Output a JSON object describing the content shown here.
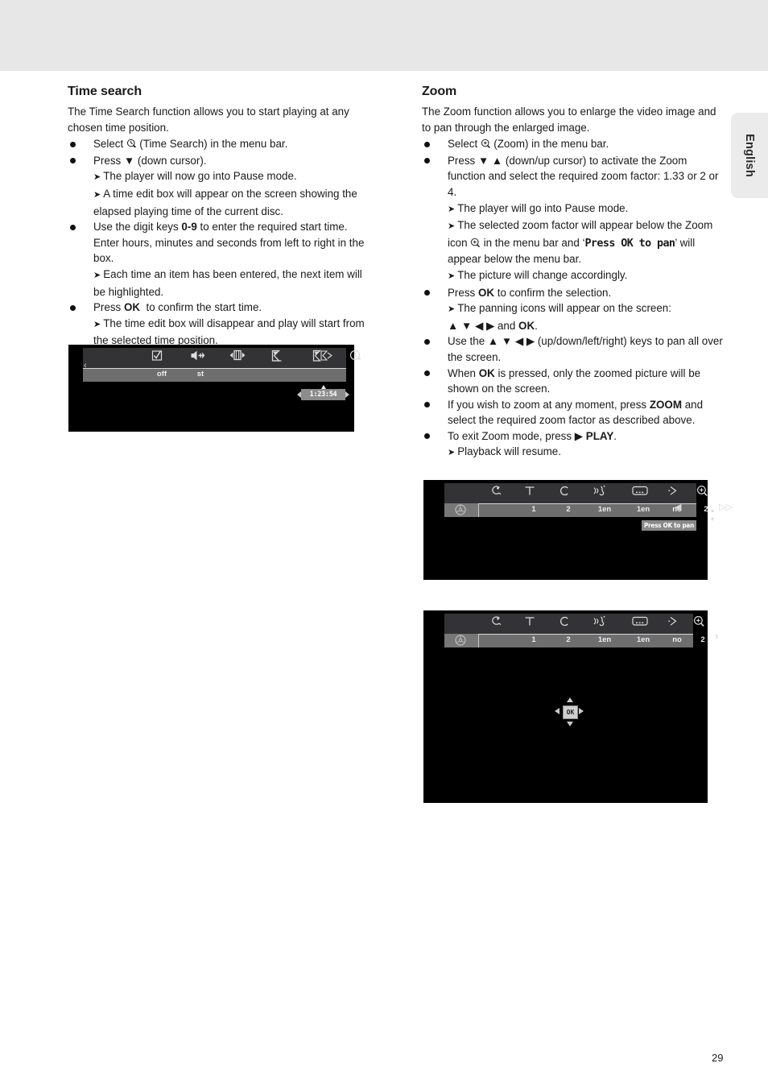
{
  "language_tab": {
    "label": "English"
  },
  "page_number": "29",
  "left_column": {
    "heading": "Time search",
    "intro": "The Time Search function allows you to start playing at any chosen time position.",
    "items": [
      {
        "kind": "bullet",
        "parts": [
          "Select ",
          "(Time Search) in the menu bar."
        ],
        "icon": "time-search-icon"
      },
      {
        "kind": "bullet",
        "text": "Press ▼ (down cursor)."
      },
      {
        "kind": "arrow",
        "text": "The player will now go into Pause mode."
      },
      {
        "kind": "arrow",
        "text": "A time edit box will appear on the screen showing the elapsed playing time of the current disc."
      },
      {
        "kind": "bullet",
        "text": "Use the digit keys 0-9 to enter the required start time. Enter hours, minutes and seconds from left to right in the box.",
        "bold": "0-9"
      },
      {
        "kind": "arrow",
        "text": "Each time an item has been entered, the next item will be highlighted."
      },
      {
        "kind": "bullet",
        "text": "Press OK  to confirm the start time.",
        "bold": "OK"
      },
      {
        "kind": "arrow",
        "text": "The time edit box will disappear and play will start from the selected time position."
      }
    ]
  },
  "right_column": {
    "heading": "Zoom",
    "intro": "The Zoom function allows you to enlarge the video image and to pan through the enlarged image.",
    "items": [
      {
        "kind": "bullet",
        "text": "Select (Zoom) in the menu bar."
      },
      {
        "kind": "bullet",
        "text": "Press ▼ ▲ (down/up cursor) to activate the Zoom function and select the required zoom factor: 1.33 or 2 or 4."
      },
      {
        "kind": "arrow",
        "text": "The player will go into Pause mode."
      },
      {
        "kind": "arrow",
        "text": "The selected zoom factor will appear below the Zoom icon in the menu bar and ‘Press OK to pan’ will appear below the menu bar."
      },
      {
        "kind": "arrow",
        "text": "The picture will change accordingly."
      },
      {
        "kind": "bullet",
        "text": "Press OK to confirm the selection."
      },
      {
        "kind": "arrow",
        "text": "The panning icons will appear on the screen:"
      },
      {
        "kind": "plain",
        "text": "▲ ▼ ◀ ▶ and OK."
      },
      {
        "kind": "bullet",
        "text": "Use the ▲ ▼ ◀ ▶ (up/down/left/right) keys to pan all over the screen."
      },
      {
        "kind": "bullet",
        "text": "When OK is pressed, only the zoomed picture will be shown on the screen."
      },
      {
        "kind": "bullet",
        "text": "If you wish to zoom at any moment, press ZOOM and select the required zoom factor as described above."
      },
      {
        "kind": "bullet",
        "text": "To exit Zoom mode, press ▶ PLAY."
      },
      {
        "kind": "arrow",
        "text": "Playback will resume."
      }
    ],
    "press_ok_to_pan_inline": "Press OK to pan"
  },
  "screenshots": {
    "time_search": {
      "name": "time-search-osd",
      "menu_icons": [
        "subtitle-check-icon",
        "audio-language-icon",
        "screen-format-icon",
        "slow-motion-icon",
        "fast-forward-icon",
        "time-search-icon"
      ],
      "menu_values": [
        "off",
        "st",
        "",
        "",
        "",
        ""
      ],
      "time_edit_value": "1:23:54",
      "left_arrow": "‹"
    },
    "zoom_pan": {
      "name": "zoom-press-ok-osd",
      "disc_badge": "disc-icon",
      "menu_icons": [
        "disc-angle-icon",
        "title-icon",
        "chapter-icon",
        "audio-language-icon",
        "subtitle-icon",
        "angle-icon",
        "zoom-icon"
      ],
      "menu_values": [
        "",
        "1",
        "2",
        "1en",
        "1en",
        "no",
        "2"
      ],
      "zoom_value": "2",
      "status_text": "Press OK to pan"
    },
    "zoom_icons": {
      "name": "zoom-panning-osd",
      "disc_badge": "disc-icon",
      "menu_icons": [
        "disc-angle-icon",
        "title-icon",
        "chapter-icon",
        "audio-language-icon",
        "subtitle-icon",
        "angle-icon",
        "zoom-icon"
      ],
      "menu_values": [
        "",
        "1",
        "2",
        "1en",
        "1en",
        "no",
        "2"
      ],
      "ok_label": "OK"
    }
  },
  "colors": {
    "band": "#e7e7e7",
    "tab": "#ebebeb",
    "osd_bg": "#000000",
    "menu_top": "#333335",
    "menu_bottom": "#6e6e6e",
    "highlight": "#8a8a8a"
  }
}
